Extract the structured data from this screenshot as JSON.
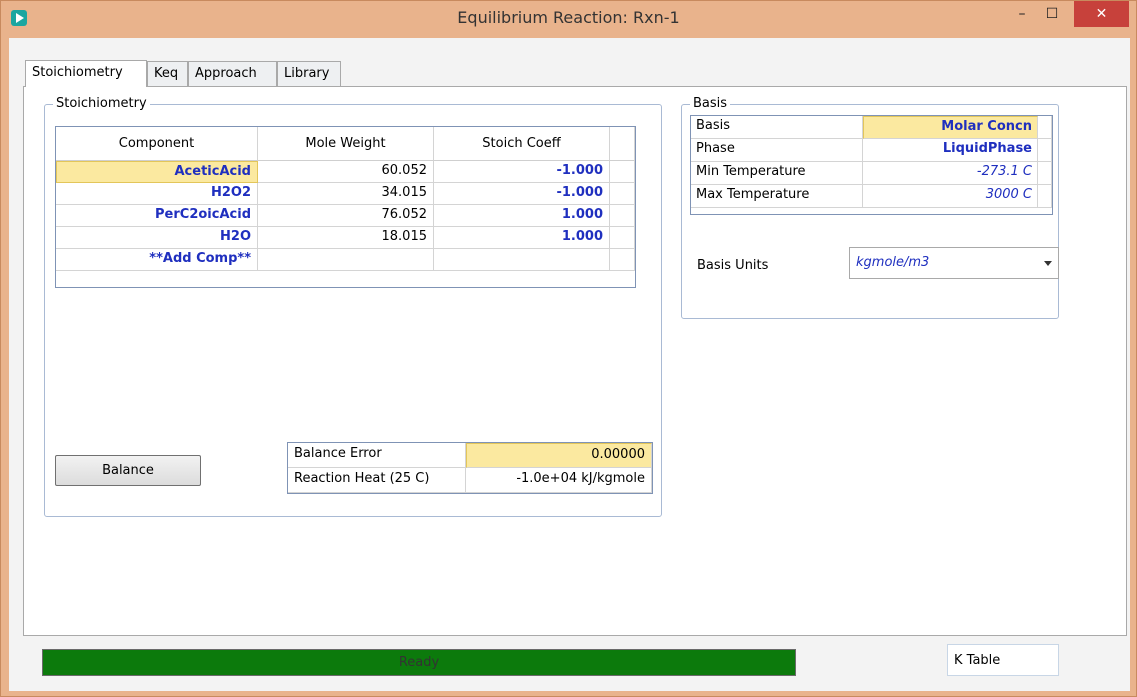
{
  "window": {
    "title": "Equilibrium Reaction: Rxn-1",
    "minimize_glyph": "–",
    "maximize_glyph": "☐",
    "close_glyph": "✕"
  },
  "tabs": [
    {
      "label": "Stoichiometry",
      "active": true
    },
    {
      "label": "Keq",
      "active": false
    },
    {
      "label": "Approach",
      "active": false
    },
    {
      "label": "Library",
      "active": false
    }
  ],
  "stoichiometry": {
    "group_label": "Stoichiometry",
    "columns": [
      "Component",
      "Mole Weight",
      "Stoich Coeff"
    ],
    "rows": [
      {
        "component": "AceticAcid",
        "mole_weight": "60.052",
        "stoich_coeff": "-1.000"
      },
      {
        "component": "H2O2",
        "mole_weight": "34.015",
        "stoich_coeff": "-1.000"
      },
      {
        "component": "PerC2oicAcid",
        "mole_weight": "76.052",
        "stoich_coeff": "1.000"
      },
      {
        "component": "H2O",
        "mole_weight": "18.015",
        "stoich_coeff": "1.000"
      },
      {
        "component": "**Add Comp**",
        "mole_weight": "",
        "stoich_coeff": ""
      }
    ],
    "balance_button": "Balance",
    "balance_error_label": "Balance Error",
    "balance_error_value": "0.00000",
    "reaction_heat_label": "Reaction Heat (25 C)",
    "reaction_heat_value": "-1.0e+04 kJ/kgmole"
  },
  "basis": {
    "group_label": "Basis",
    "rows": [
      {
        "label": "Basis",
        "value": "Molar Concn"
      },
      {
        "label": "Phase",
        "value": "LiquidPhase"
      },
      {
        "label": "Min Temperature",
        "value": "-273.1 C"
      },
      {
        "label": "Max Temperature",
        "value": "3000 C"
      }
    ],
    "units_label": "Basis Units",
    "units_value": "kgmole/m3"
  },
  "status": {
    "text": "Ready",
    "progress": 1.0,
    "color": "#0c7a0c"
  },
  "k_table": "K Table"
}
